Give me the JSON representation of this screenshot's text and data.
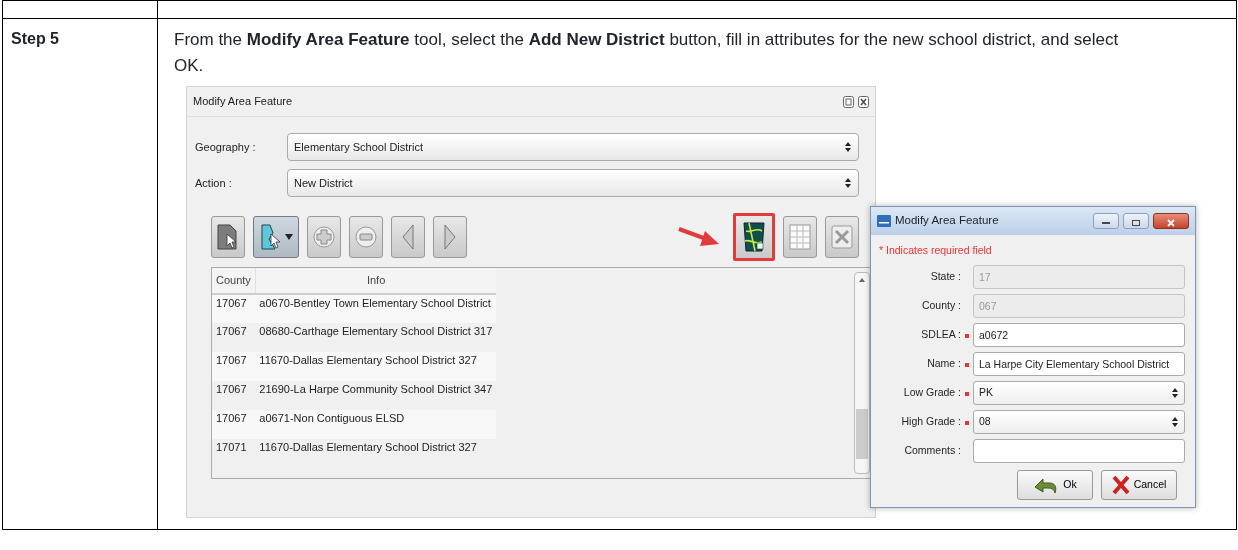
{
  "step": {
    "label": "Step 5",
    "instruction": "From the **Modify Area Feature** tool, select the **Add New District** button, fill in attributes for the new school district, and select OK."
  },
  "main_window": {
    "title": "Modify Area Feature",
    "fields": [
      {
        "label": "Geography :",
        "value": "Elementary School District"
      },
      {
        "label": "Action :",
        "value": "New District"
      }
    ],
    "toolbar": [
      {
        "kind": "select",
        "pressed": false
      },
      {
        "kind": "select-menu",
        "pressed": true
      },
      {
        "kind": "plus",
        "pressed": false
      },
      {
        "kind": "minus",
        "pressed": false
      },
      {
        "kind": "prev",
        "pressed": false
      },
      {
        "kind": "next",
        "pressed": false
      }
    ],
    "toolbar_right": [
      {
        "kind": "add-district",
        "highlighted": true
      },
      {
        "kind": "table",
        "highlighted": false
      },
      {
        "kind": "close",
        "highlighted": false
      }
    ],
    "table": {
      "columns": [
        "County",
        "Info"
      ],
      "rows": [
        [
          "17067",
          "a0670-Bentley Town Elementary School District"
        ],
        [
          "17067",
          "08680-Carthage Elementary School District 317"
        ],
        [
          "17067",
          "11670-Dallas Elementary School District 327"
        ],
        [
          "17067",
          "21690-La Harpe Community School District 347"
        ],
        [
          "17067",
          "a0671-Non Contiguous ELSD"
        ],
        [
          "17071",
          "11670-Dallas Elementary School District 327"
        ]
      ]
    }
  },
  "dialog": {
    "title": "Modify Area Feature",
    "required_note": "* Indicates required field",
    "fields": [
      {
        "label": "State :",
        "value": "17",
        "kind": "text",
        "required": false,
        "disabled": true
      },
      {
        "label": "County :",
        "value": "067",
        "kind": "text",
        "required": false,
        "disabled": true
      },
      {
        "label": "SDLEA :",
        "value": "a0672",
        "kind": "text",
        "required": true,
        "disabled": false
      },
      {
        "label": "Name :",
        "value": "La Harpe City Elementary School District",
        "kind": "text",
        "required": true,
        "disabled": false
      },
      {
        "label": "Low Grade :",
        "value": "PK",
        "kind": "combo",
        "required": true,
        "disabled": false
      },
      {
        "label": "High Grade :",
        "value": "08",
        "kind": "combo",
        "required": true,
        "disabled": false
      },
      {
        "label": "Comments :",
        "kind": "text",
        "required": false,
        "disabled": false
      }
    ],
    "buttons": [
      {
        "kind": "ok",
        "label": "Ok"
      },
      {
        "kind": "cancel",
        "label": "Cancel"
      }
    ]
  }
}
